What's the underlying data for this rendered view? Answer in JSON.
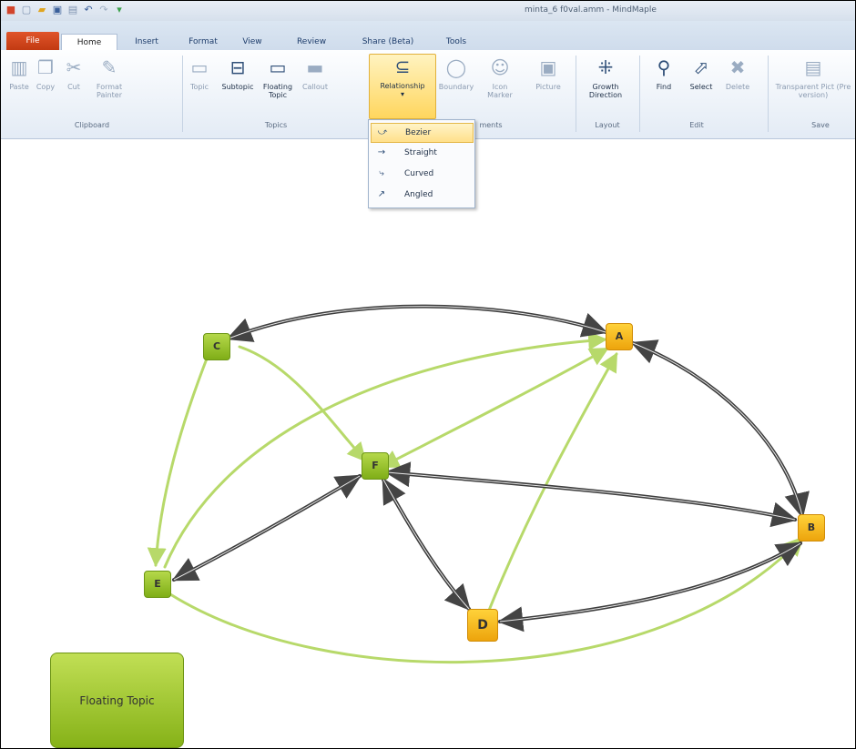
{
  "window": {
    "title": "minta_6 f0val.amm - MindMaple"
  },
  "tabs": [
    {
      "label": "File"
    },
    {
      "label": "Home"
    },
    {
      "label": "Insert"
    },
    {
      "label": "Format"
    },
    {
      "label": "View"
    },
    {
      "label": "Review"
    },
    {
      "label": "Share (Beta)"
    },
    {
      "label": "Tools"
    }
  ],
  "ribbon": {
    "buttons": [
      {
        "label": "Paste",
        "icon": "paste-icon"
      },
      {
        "label": "Copy",
        "icon": "copy-icon"
      },
      {
        "label": "Cut",
        "icon": "cut-icon"
      },
      {
        "label": "Format Painter",
        "icon": "format-painter-icon"
      },
      {
        "label": "Topic",
        "icon": "topic-icon"
      },
      {
        "label": "Subtopic",
        "icon": "subtopic-icon"
      },
      {
        "label": "Floating Topic",
        "icon": "floating-topic-icon"
      },
      {
        "label": "Callout",
        "icon": "callout-icon"
      },
      {
        "label": "Relationship",
        "icon": "relationship-icon"
      },
      {
        "label": "Boundary",
        "icon": "boundary-icon"
      },
      {
        "label": "Icon Marker",
        "icon": "icon-marker-icon"
      },
      {
        "label": "Picture",
        "icon": "picture-icon"
      },
      {
        "label": "Growth Direction",
        "icon": "growth-direction-icon"
      },
      {
        "label": "Find",
        "icon": "find-icon"
      },
      {
        "label": "Select",
        "icon": "select-icon"
      },
      {
        "label": "Delete",
        "icon": "delete-icon"
      },
      {
        "label": "Transparent Pict (Pre version)",
        "icon": "transparent-picture-icon"
      }
    ],
    "groups": [
      "Clipboard",
      "Topics",
      "ments",
      "Layout",
      "Edit",
      "Save"
    ]
  },
  "relationship_menu": {
    "items": [
      {
        "label": "Bezier",
        "icon": "bezier-line-icon",
        "selected": true
      },
      {
        "label": "Straight",
        "icon": "straight-line-icon",
        "selected": false
      },
      {
        "label": "Curved",
        "icon": "curved-line-icon",
        "selected": false
      },
      {
        "label": "Angled",
        "icon": "angled-line-icon",
        "selected": false
      }
    ]
  },
  "map": {
    "topics": [
      {
        "id": "A",
        "color": "orange"
      },
      {
        "id": "B",
        "color": "orange"
      },
      {
        "id": "C",
        "color": "green"
      },
      {
        "id": "D",
        "color": "orange"
      },
      {
        "id": "E",
        "color": "green"
      },
      {
        "id": "F",
        "color": "green"
      }
    ],
    "floating_topic": "Floating Topic",
    "colors": {
      "green": "#9cc63a",
      "orange": "#f5b41c",
      "light_arrow": "#b7d96a",
      "dark_arrow": "#4a4a4a"
    }
  }
}
